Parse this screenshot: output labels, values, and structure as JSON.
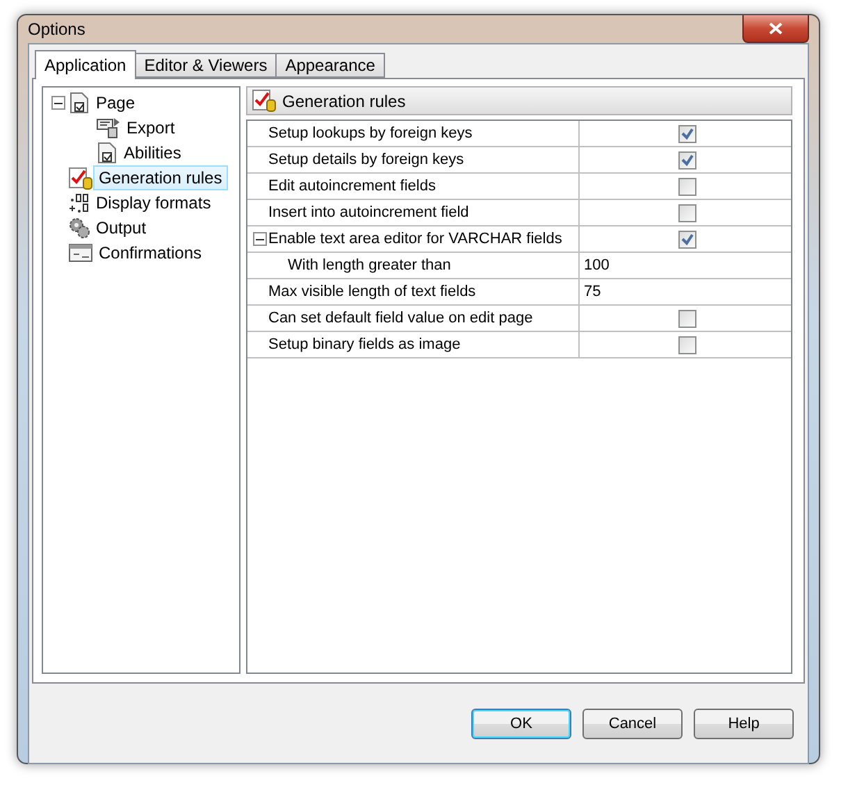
{
  "window": {
    "title": "Options"
  },
  "tabs": [
    {
      "label": "Application",
      "selected": true
    },
    {
      "label": "Editor & Viewers",
      "selected": false
    },
    {
      "label": "Appearance",
      "selected": false
    }
  ],
  "tree": [
    {
      "label": "Page",
      "kind": "page",
      "expanded": true,
      "selected": false,
      "children": [
        {
          "label": "Export",
          "kind": "export",
          "selected": false
        },
        {
          "label": "Abilities",
          "kind": "page",
          "selected": false
        }
      ]
    },
    {
      "label": "Generation rules",
      "kind": "rules",
      "selected": true
    },
    {
      "label": "Display formats",
      "kind": "formats",
      "selected": false
    },
    {
      "label": "Output",
      "kind": "gears",
      "selected": false
    },
    {
      "label": "Confirmations",
      "kind": "dialog",
      "selected": false
    }
  ],
  "panel": {
    "title": "Generation rules"
  },
  "rules": [
    {
      "label": "Setup lookups by foreign keys",
      "kind": "check",
      "checked": true
    },
    {
      "label": "Setup details by foreign keys",
      "kind": "check",
      "checked": true
    },
    {
      "label": "Edit autoincrement fields",
      "kind": "check",
      "checked": false
    },
    {
      "label": "Insert into autoincrement field",
      "kind": "check",
      "checked": false
    },
    {
      "label": "Enable text area editor for VARCHAR fields",
      "kind": "check",
      "checked": true,
      "expanded": true,
      "children": [
        {
          "label": "With length greater than",
          "kind": "value",
          "value": "100"
        }
      ]
    },
    {
      "label": "Max visible length of text fields",
      "kind": "value",
      "value": "75"
    },
    {
      "label": "Can set default field value on edit page",
      "kind": "check",
      "checked": false
    },
    {
      "label": "Setup binary fields as image",
      "kind": "check",
      "checked": false
    }
  ],
  "buttons": [
    {
      "label": "OK",
      "default": true
    },
    {
      "label": "Cancel",
      "default": false
    },
    {
      "label": "Help",
      "default": false
    }
  ]
}
